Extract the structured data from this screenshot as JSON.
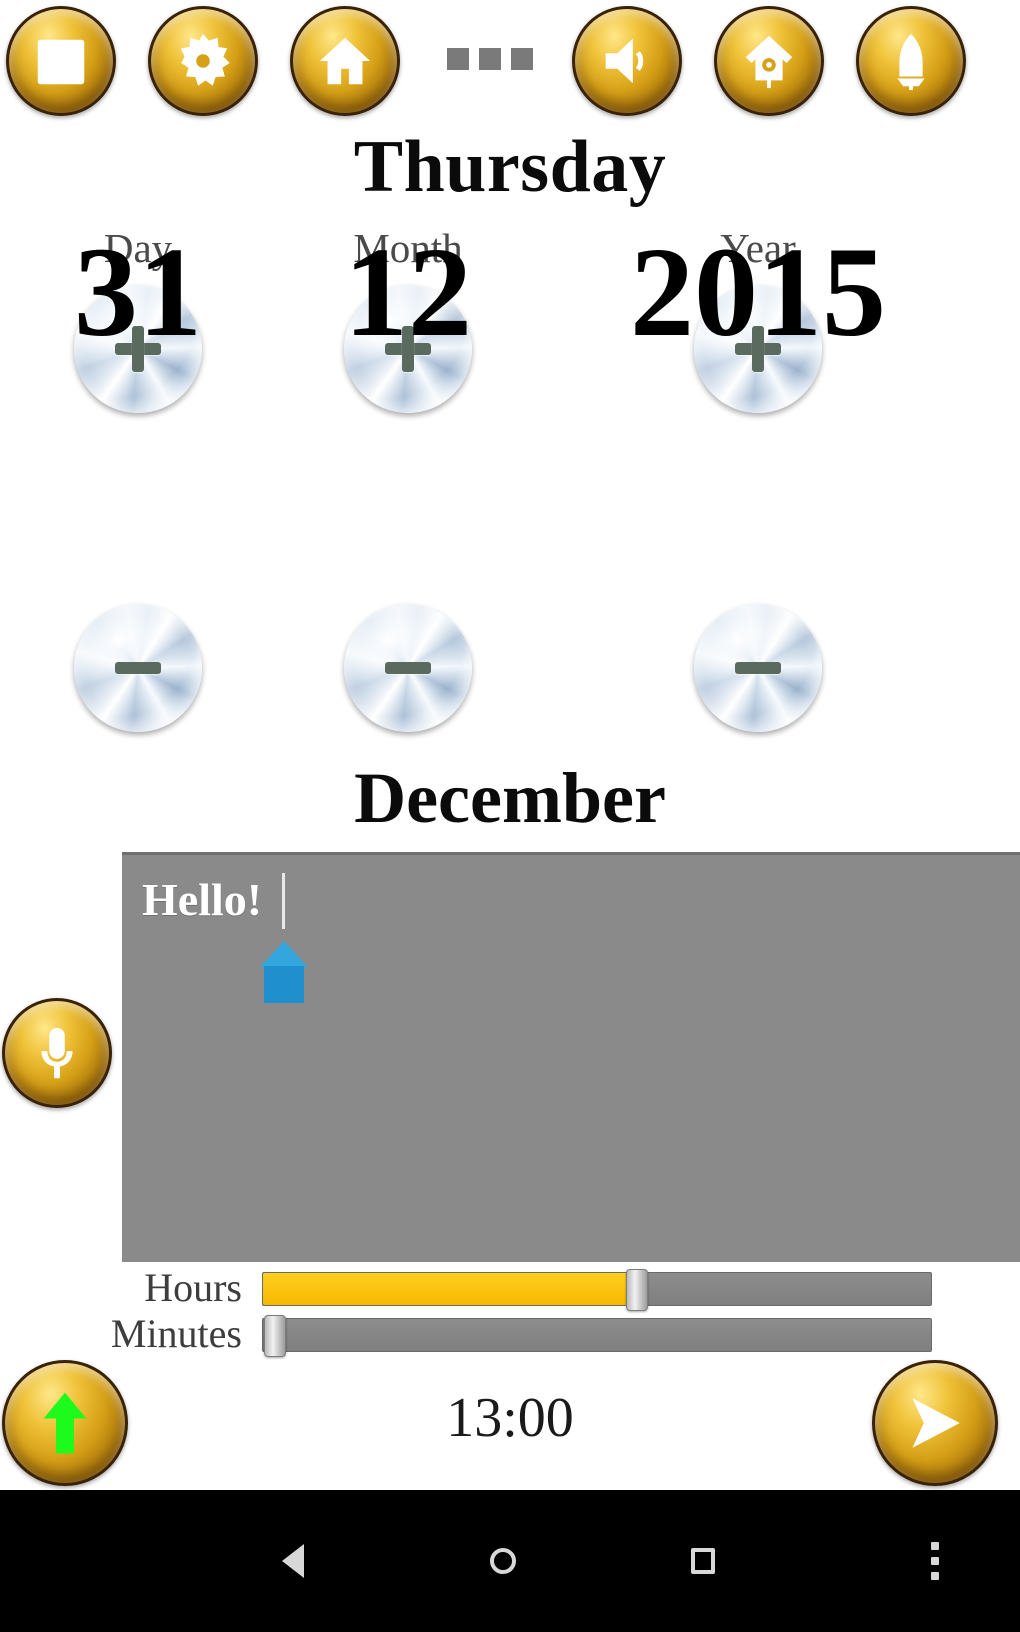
{
  "toolbar": {
    "buttons": [
      {
        "name": "calendar",
        "icon": "calendar-icon",
        "label": "Calendar"
      },
      {
        "name": "settings",
        "icon": "gear-icon",
        "label": "Settings"
      },
      {
        "name": "home",
        "icon": "home-icon",
        "label": "Home"
      },
      {
        "name": "volume",
        "icon": "speaker-icon",
        "label": "Volume"
      },
      {
        "name": "cuckoo",
        "icon": "birdhouse-icon",
        "label": "Cuckoo"
      },
      {
        "name": "alarm",
        "icon": "bell-icon",
        "label": "Alarm"
      }
    ],
    "overflow_dots": "...",
    "gold": "#d6a017"
  },
  "date": {
    "weekday": "Thursday",
    "day_label": "Day",
    "month_label": "Month",
    "year_label": "Year",
    "day_value": "31",
    "month_value": "12",
    "year_value": "2015",
    "month_name": "December",
    "increment_icon": "plus-knob-icon",
    "decrement_icon": "minus-knob-icon"
  },
  "message": {
    "text": "Hello!",
    "placeholder": "",
    "background": "#8a8a8a",
    "handle_color": "#1f8fce",
    "mic_icon": "microphone-icon"
  },
  "sliders": {
    "hours": {
      "label": "Hours",
      "value": 13,
      "min": 0,
      "max": 23,
      "percent": 56,
      "fill_color": "#f7b900"
    },
    "minutes": {
      "label": "Minutes",
      "value": 0,
      "min": 0,
      "max": 59,
      "percent": 0,
      "fill_color": "#f7b900"
    }
  },
  "footer": {
    "time": "13:00",
    "left_button": {
      "icon": "green-up-arrow-icon",
      "label": "Up"
    },
    "right_button": {
      "icon": "send-arrow-icon",
      "label": "Send"
    }
  },
  "navbar": {
    "back": "back-icon",
    "home": "home-circle-icon",
    "recents": "recents-square-icon",
    "menu": "overflow-menu-icon"
  }
}
